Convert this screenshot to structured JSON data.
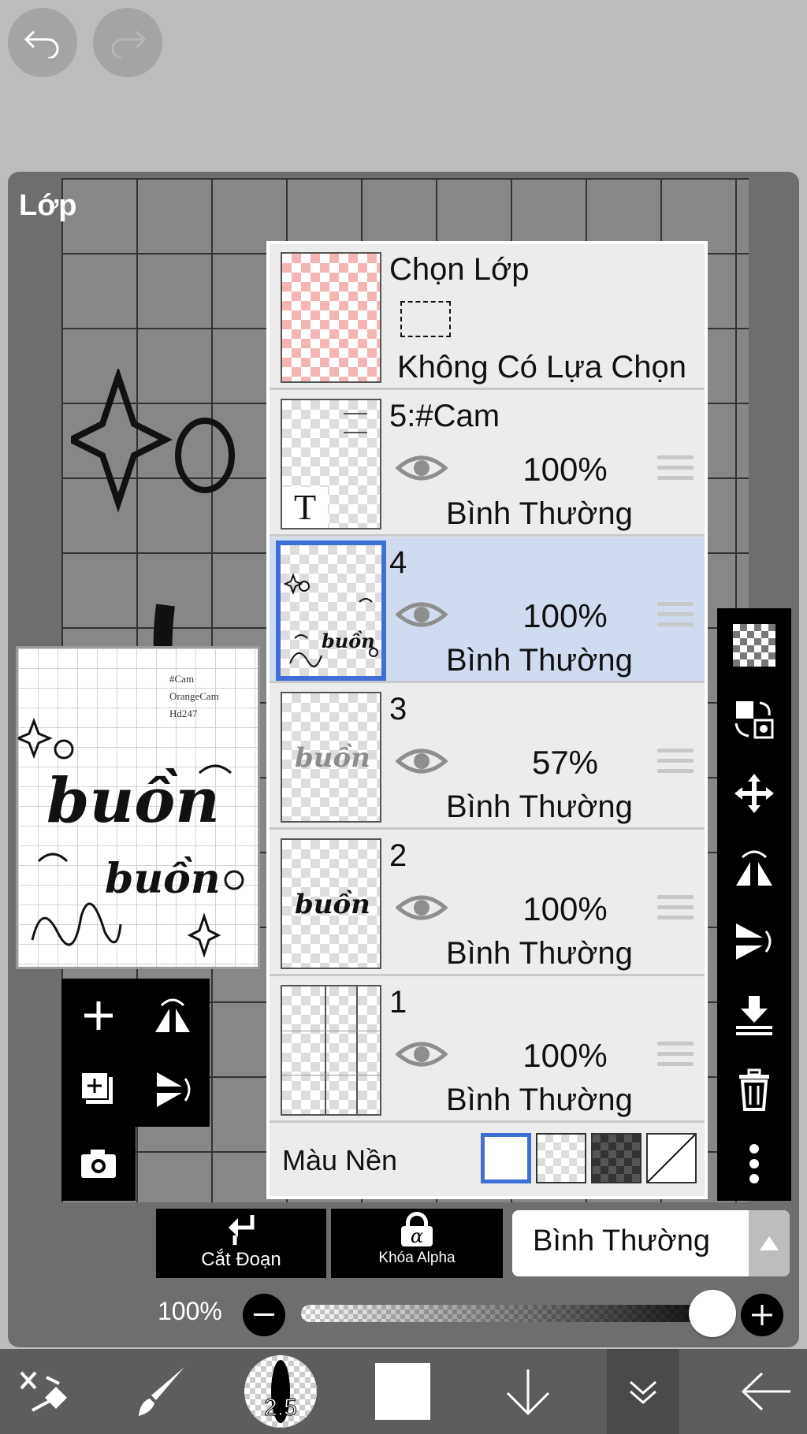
{
  "top": {
    "undo_icon": "undo-icon",
    "redo_icon": "redo-icon"
  },
  "panel": {
    "title": "Lớp"
  },
  "preview": {
    "tags": [
      "#Cam",
      "OrangeCam",
      "Hd247"
    ]
  },
  "selection_layer": {
    "title": "Chọn Lớp",
    "status": "Không Có Lựa Chọn"
  },
  "layers": [
    {
      "name": "5:#Cam",
      "opacity": "100%",
      "blend": "Bình Thường",
      "selected": false
    },
    {
      "name": "4",
      "opacity": "100%",
      "blend": "Bình Thường",
      "selected": true
    },
    {
      "name": "3",
      "opacity": "57%",
      "blend": "Bình Thường",
      "selected": false
    },
    {
      "name": "2",
      "opacity": "100%",
      "blend": "Bình Thường",
      "selected": false
    },
    {
      "name": "1",
      "opacity": "100%",
      "blend": "Bình Thường",
      "selected": false
    }
  ],
  "thumb_text": {
    "layer5_letter": "T",
    "layer3_word": "buồn",
    "layer2_word": "buồn",
    "layer4_word": "buồn"
  },
  "background": {
    "label": "Màu Nền"
  },
  "actions": {
    "clip_label": "Cắt Đoạn",
    "alpha_label": "Khóa Alpha",
    "alpha_glyph": "α",
    "blend_mode": "Bình Thường"
  },
  "opacity_slider": {
    "value_label": "100%",
    "value": 1.0
  },
  "bottom": {
    "brush_size": "2.5"
  },
  "colors": {
    "accent": "#3f6fd6",
    "selected_row": "#d0dbef",
    "panel_bg": "#6e6e6e"
  }
}
